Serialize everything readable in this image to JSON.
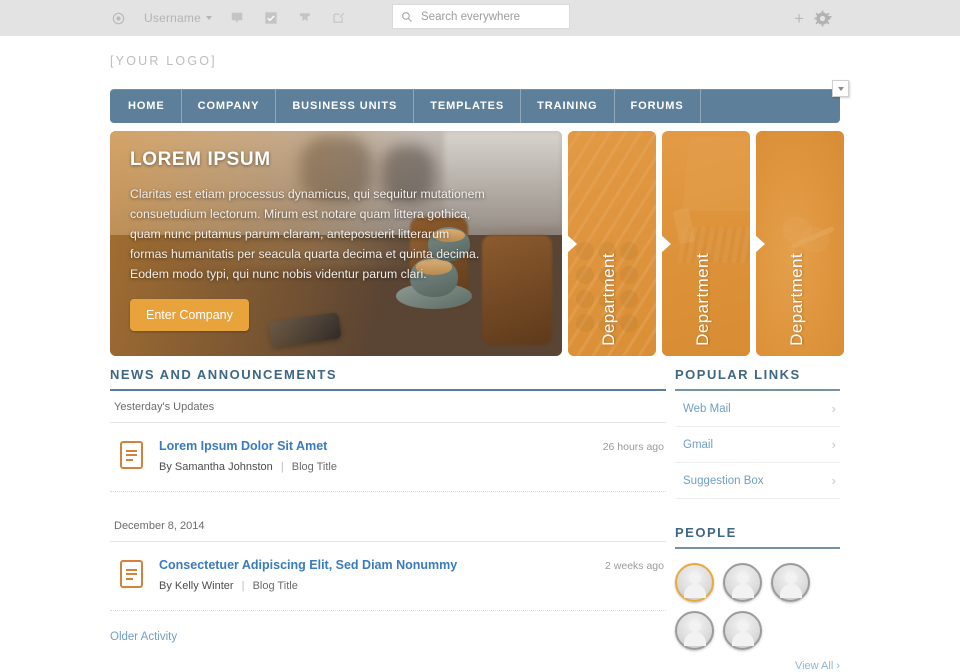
{
  "toolbar": {
    "avatar_icon": "circle-avatar-icon",
    "username": "Username",
    "icons": [
      {
        "name": "speech-bubble-icon"
      },
      {
        "name": "checkbox-check-icon"
      },
      {
        "name": "bookmark-icon"
      },
      {
        "name": "compose-icon"
      }
    ],
    "search": {
      "placeholder": "Search everywhere",
      "value": "",
      "icon": "search-icon"
    },
    "add_icon": "plus-icon",
    "caret_icon": "chevron-down-icon",
    "settings_icon": "gear-icon"
  },
  "brand": {
    "logo_text": "[YOUR LOGO]"
  },
  "nav": {
    "items": [
      {
        "label": "HOME"
      },
      {
        "label": "COMPANY"
      },
      {
        "label": "BUSINESS UNITS"
      },
      {
        "label": "TEMPLATES"
      },
      {
        "label": "TRAINING"
      },
      {
        "label": "FORUMS"
      }
    ],
    "dropdown_icon": "chevron-down-icon",
    "background_color": "#5d7f99"
  },
  "hero": {
    "title": "LOREM IPSUM",
    "body": "Claritas est etiam processus dynamicus, qui sequitur mutationem consuetudium lectorum. Mirum est notare quam littera gothica, quam nunc putamus parum claram, anteposuerit litterarum formas humanitatis per seacula quarta decima et quinta decima. Eodem modo typi, qui nunc nobis videntur parum clari.",
    "button_label": "Enter Company",
    "button_color": "#e8a33d"
  },
  "departments": [
    {
      "label": "Department"
    },
    {
      "label": "Department"
    },
    {
      "label": "Department"
    }
  ],
  "news": {
    "heading": "NEWS AND ANNOUNCEMENTS",
    "groups": [
      {
        "date_label": "Yesterday's Updates",
        "items": [
          {
            "title": "Lorem Ipsum Dolor Sit Amet",
            "author": "By Samantha Johnston",
            "separator": "|",
            "blog": "Blog Title",
            "time": "26 hours ago",
            "icon": "document-icon"
          }
        ]
      },
      {
        "date_label": "December 8, 2014",
        "items": [
          {
            "title": "Consectetuer Adipiscing Elit, Sed Diam Nonummy",
            "author": "By Kelly Winter",
            "separator": "|",
            "blog": "Blog Title",
            "time": "2 weeks ago",
            "icon": "document-icon"
          }
        ]
      }
    ],
    "older_link": "Older Activity"
  },
  "popular_links": {
    "heading": "POPULAR LINKS",
    "items": [
      {
        "label": "Web Mail",
        "icon": "chevron-right-icon"
      },
      {
        "label": "Gmail",
        "icon": "chevron-right-icon"
      },
      {
        "label": "Suggestion Box",
        "icon": "chevron-right-icon"
      }
    ]
  },
  "people": {
    "heading": "PEOPLE",
    "avatars": [
      {
        "highlighted": true
      },
      {
        "highlighted": false
      },
      {
        "highlighted": false
      },
      {
        "highlighted": false
      },
      {
        "highlighted": false
      }
    ],
    "view_all": "View All ›",
    "highlight_color": "#e8a93d"
  }
}
